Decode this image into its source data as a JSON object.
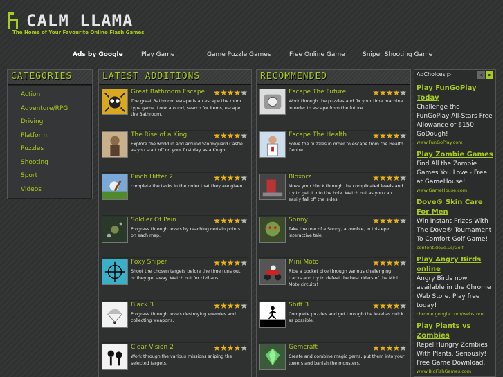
{
  "site": {
    "logo_text": "CALM LLAMA",
    "tagline": "The Home of Your Favourite Online Flash Games"
  },
  "topnav": {
    "items": [
      "Ads by Google",
      "Play Game",
      "Game Puzzle Games",
      "Free Online Game",
      "Sniper Shooting Game"
    ]
  },
  "categories": {
    "heading": "Categories",
    "items": [
      "Action",
      "Adventure/RPG",
      "Driving",
      "Platform",
      "Puzzles",
      "Shooting",
      "Sport",
      "Videos"
    ]
  },
  "latest": {
    "heading": "Latest Additions",
    "games": [
      {
        "title": "Great Bathroom Escape",
        "rating": 4,
        "desc": "The great Bathroom escape is an escape the room type game. Look around, search for items, escape the Bathroom.",
        "icon": "spider-icon"
      },
      {
        "title": "The Rise of a King",
        "rating": 4,
        "desc": "Explore the world in and around Stormguard Castle as you start off on your first day as a Knight.",
        "icon": "knight-icon"
      },
      {
        "title": "Pinch Hitter 2",
        "rating": 4,
        "desc": "complete the tasks in the order that they are given.",
        "icon": "baseball-icon"
      },
      {
        "title": "Soldier Of Pain",
        "rating": 4,
        "desc": "Progress through levels by reaching certain points on each map.",
        "icon": "soldier-icon"
      },
      {
        "title": "Foxy Sniper",
        "rating": 4,
        "desc": "Shoot the chosen targets before the time runs out or they get away. Watch out for civilians.",
        "icon": "crosshair-icon"
      },
      {
        "title": "Black 3",
        "rating": 4,
        "desc": "Progress through levels destroying enemies and collecting weapons.",
        "icon": "parachute-icon"
      },
      {
        "title": "Clear Vision 2",
        "rating": 4,
        "desc": "Work through the various missions sniping the selected targets.",
        "icon": "stickman-icon"
      }
    ]
  },
  "recommended": {
    "heading": "Recommended",
    "games": [
      {
        "title": "Escape The Future",
        "rating": 4,
        "desc": "Work through the puzzles and fix your time machine in order to escape from the future.",
        "icon": "machine-icon"
      },
      {
        "title": "Escape The Health",
        "rating": 4,
        "desc": "Solve the puzzles in order to escape from the Health Centre.",
        "icon": "doctor-icon"
      },
      {
        "title": "Bloxorz",
        "rating": 4,
        "desc": "Move your block through the complicated levels and try to get it into the hole. Watch out as you can easily fall off the sides.",
        "icon": "block-icon"
      },
      {
        "title": "Sonny",
        "rating": 4,
        "desc": "Take the role of a Sonny, a zombie, in this epic interactive tale.",
        "icon": "zombie-icon"
      },
      {
        "title": "Mini Moto",
        "rating": 4,
        "desc": "Ride a pocket bike through various challenging tracks and try to defeat the best riders of the Mini Moto circuits!",
        "icon": "moto-icon"
      },
      {
        "title": "Shift 3",
        "rating": 4,
        "desc": "Complete puzzles and get through the level as quick as possible.",
        "icon": "runner-icon"
      },
      {
        "title": "Gemcraft",
        "rating": 4,
        "desc": "Create and combine magic gems, put them into your towers and banish the monsters.",
        "icon": "gem-icon"
      }
    ]
  },
  "ads": {
    "label": "AdChoices",
    "prev": "<",
    "next": ">",
    "items": [
      {
        "title": "Play FunGoPlay Today",
        "text": "Challenge the FunGoPlay All-Stars Free Allowance of $150 GoDough!",
        "url": "www.FunGoPlay.com"
      },
      {
        "title": "Play Zombie Games",
        "text": "Find All the Zombie Games You Love - Free at GameHouse!",
        "url": "www.GameHouse.com"
      },
      {
        "title": "Dove® Skin Care For Men",
        "text": "Win Instant Prizes With The Dove® Tournament To Comfort Golf Game!",
        "url": "content.dove.us/Golf"
      },
      {
        "title": "Play Angry Birds online",
        "text": "Angry Birds now available in the Chrome Web Store. Play free today!",
        "url": "chrome.google.com/webstore"
      },
      {
        "title": "Play Plants vs Zombies",
        "text": "Repel Hungry Zombies With Plants. Seriously! Free Game Download.",
        "url": "www.BigFishGames.com"
      }
    ]
  },
  "colors": {
    "accent": "#a6cc1f",
    "star": "#e8b21e",
    "background": "#2e2f2f"
  }
}
